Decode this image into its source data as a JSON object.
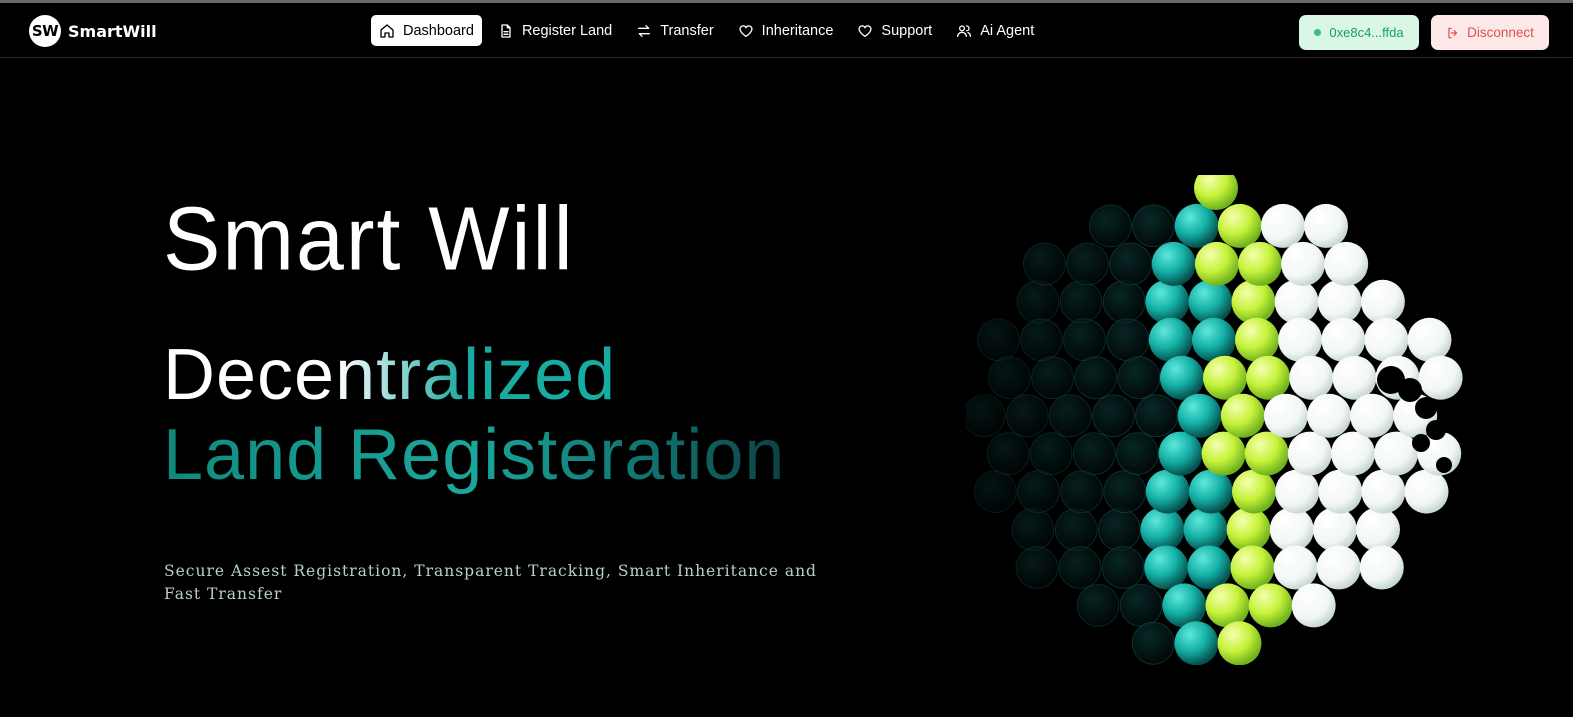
{
  "brand": {
    "logo": "SW",
    "name": "SmartWill"
  },
  "nav": {
    "items": [
      {
        "label": "Dashboard",
        "icon": "home-icon",
        "active": true
      },
      {
        "label": "Register Land",
        "icon": "document-icon",
        "active": false
      },
      {
        "label": "Transfer",
        "icon": "arrows-icon",
        "active": false
      },
      {
        "label": "Inheritance",
        "icon": "heart-icon",
        "active": false
      },
      {
        "label": "Support",
        "icon": "heart-icon",
        "active": false
      },
      {
        "label": "Ai Agent",
        "icon": "users-icon",
        "active": false
      }
    ]
  },
  "wallet": {
    "address": "0xe8c4...ffda",
    "status_color": "#36c27a"
  },
  "disconnect": {
    "label": "Disconnect",
    "icon": "logout-icon"
  },
  "hero": {
    "title": "Smart Will",
    "subtitle_line1": "Decentralized",
    "subtitle_line2": "Land Registeration",
    "tagline": "Secure Assest Registration, Transparent Tracking, Smart Inheritance and Fast Transfer"
  },
  "colors": {
    "accent_teal": "#14b0a6",
    "accent_lime": "#c6f23a",
    "background": "#000000"
  }
}
